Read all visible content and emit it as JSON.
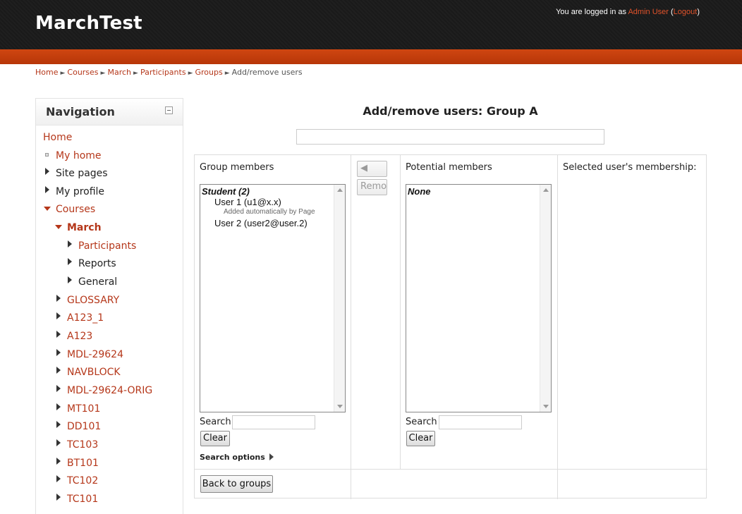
{
  "header": {
    "site_title": "MarchTest",
    "login_prefix": "You are logged in as ",
    "user_name": "Admin User",
    "logout_open": " (",
    "logout_label": "Logout",
    "logout_close": ")"
  },
  "breadcrumb": {
    "items": [
      "Home",
      "Courses",
      "March",
      "Participants",
      "Groups"
    ],
    "current": "Add/remove users",
    "separator": "►"
  },
  "navigation": {
    "title": "Navigation",
    "home": "Home",
    "my_home": "My home",
    "site_pages": "Site pages",
    "my_profile": "My profile",
    "courses": "Courses",
    "march": "March",
    "participants": "Participants",
    "reports": "Reports",
    "general": "General",
    "courses_list": [
      "GLOSSARY",
      "A123_1",
      "A123",
      "MDL-29624",
      "NAVBLOCK",
      "MDL-29624-ORIG",
      "MT101",
      "DD101",
      "TC103",
      "BT101",
      "TC102",
      "TC101"
    ]
  },
  "main": {
    "title": "Add/remove users: Group A",
    "group_members_label": "Group members",
    "potential_members_label": "Potential members",
    "membership_label": "Selected user's membership:",
    "add_button": "◀ Add",
    "remove_button": "Remove",
    "group_list": {
      "group": "Student (2)",
      "users": [
        "User 1 (u1@x.x)",
        "User 2 (user2@user.2)"
      ],
      "note": "Added automatically by Page"
    },
    "potential_list": {
      "group": "None"
    },
    "search_label": "Search",
    "clear_button": "Clear",
    "search_options": "Search options",
    "back_button": "Back to groups"
  },
  "colors": {
    "accent": "#c9400c",
    "link": "#b5371a",
    "header_bg": "#1b1b1b"
  }
}
